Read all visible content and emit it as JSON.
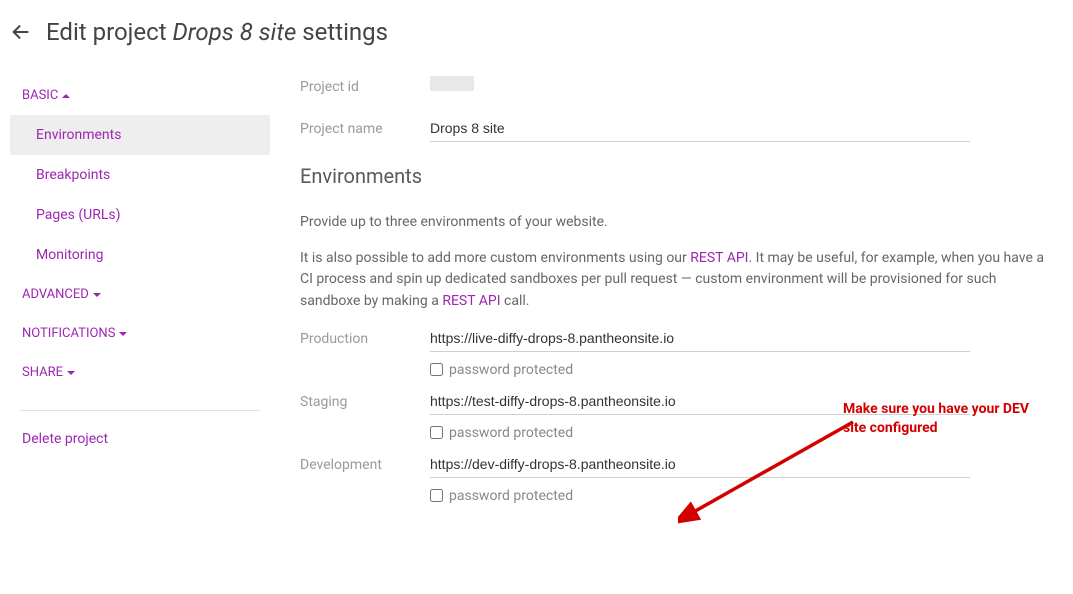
{
  "header": {
    "prefix": "Edit project",
    "project_name": "Drops 8 site",
    "suffix": "settings"
  },
  "sidebar": {
    "basic": {
      "label": "BASIC",
      "items": [
        {
          "label": "Environments",
          "active": true
        },
        {
          "label": "Breakpoints",
          "active": false
        },
        {
          "label": "Pages (URLs)",
          "active": false
        },
        {
          "label": "Monitoring",
          "active": false
        }
      ]
    },
    "advanced": {
      "label": "ADVANCED"
    },
    "notifications": {
      "label": "NOTIFICATIONS"
    },
    "share": {
      "label": "SHARE"
    },
    "delete": "Delete project"
  },
  "main": {
    "project_id_label": "Project id",
    "project_name_label": "Project name",
    "project_name_value": "Drops 8 site",
    "env_title": "Environments",
    "intro1": "Provide up to three environments of your website.",
    "intro2a": "It is also possible to add more custom environments using our ",
    "intro2_link1": "REST API",
    "intro2b": ". It may be useful, for example, when you have a CI process and spin up dedicated sandboxes per pull request — custom environment will be provisioned for such sandboxe by making a ",
    "intro2_link2": "REST API",
    "intro2c": " call.",
    "pw_protected": "password protected",
    "envs": [
      {
        "label": "Production",
        "url": "https://live-diffy-drops-8.pantheonsite.io"
      },
      {
        "label": "Staging",
        "url": "https://test-diffy-drops-8.pantheonsite.io"
      },
      {
        "label": "Development",
        "url": "https://dev-diffy-drops-8.pantheonsite.io"
      }
    ]
  },
  "annotation": "Make sure you have your DEV site configured"
}
